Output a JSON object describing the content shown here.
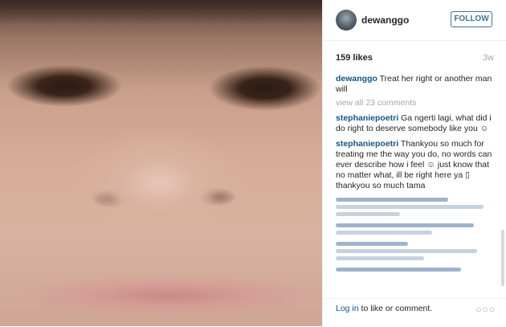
{
  "post": {
    "username": "dewanggo",
    "follow_label": "FOLLOW",
    "likes": "159 likes",
    "time": "3w",
    "caption_user": "dewanggo",
    "caption_text": "Treat her right or another man will",
    "view_all": "view all 23 comments"
  },
  "comments": [
    {
      "user": "stephaniepoetri",
      "text": "Ga ngerti lagi, what did i do right to deserve somebody like you ☺"
    },
    {
      "user": "stephaniepoetri",
      "text": "Thankyou so much for treating me the way you do, no words can ever describe how i feel ☺ just know that no matter what, ill be right here ya ▯ thankyou so much tama"
    }
  ],
  "footer": {
    "login_link": "Log in",
    "login_rest": " to like or comment.",
    "more": "○○○"
  }
}
